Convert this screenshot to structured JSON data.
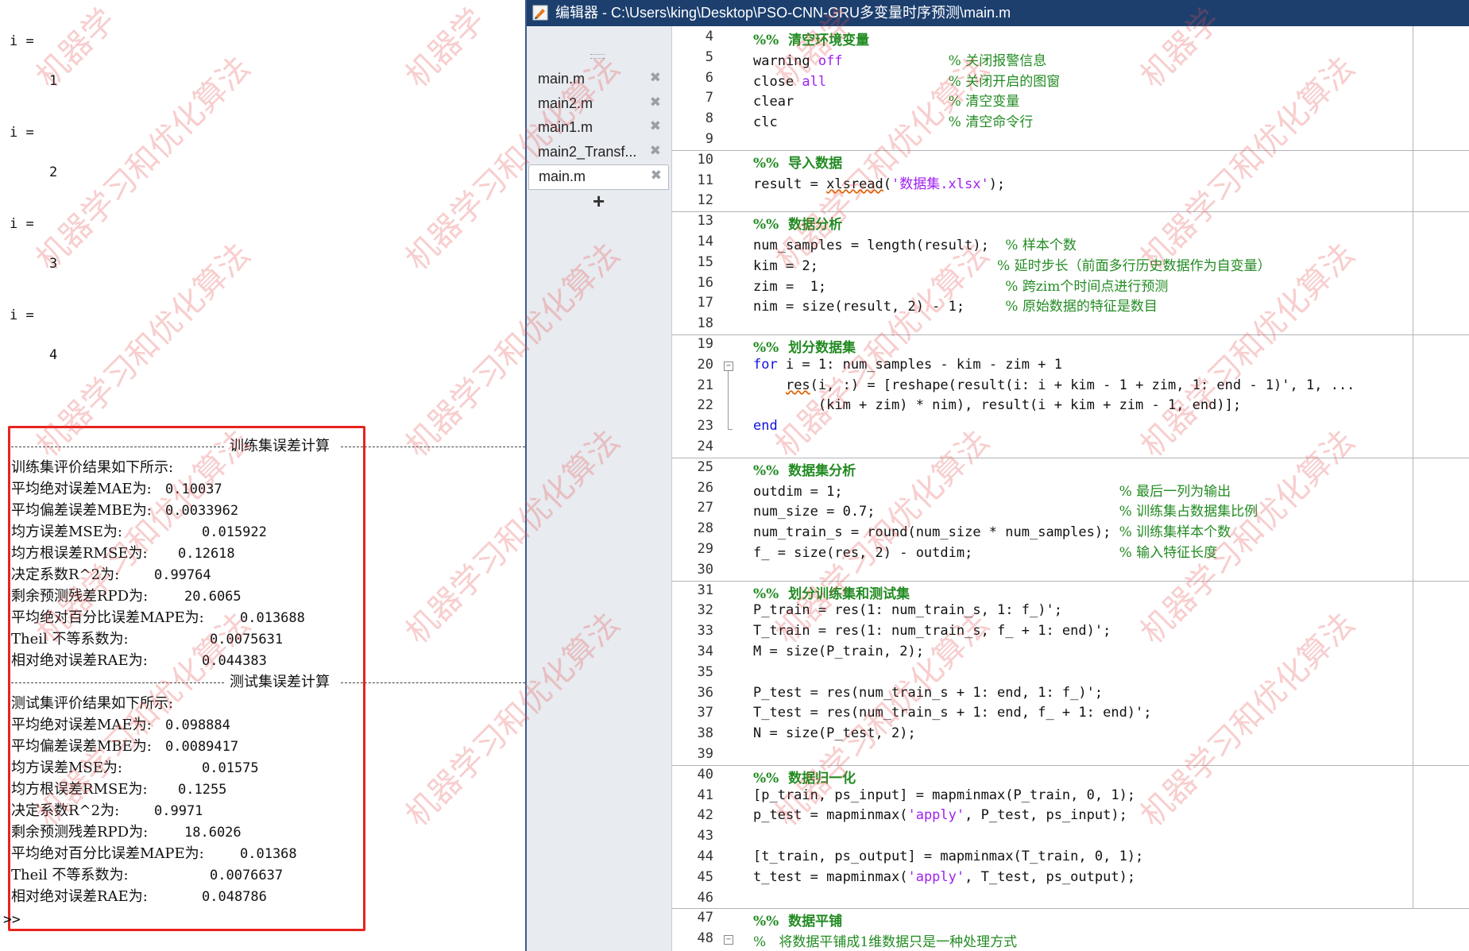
{
  "command_window": {
    "loop_output": [
      {
        "var": "i =",
        "value": "1"
      },
      {
        "var": "i =",
        "value": "2"
      },
      {
        "var": "i =",
        "value": "3"
      },
      {
        "var": "i =",
        "value": "4"
      }
    ],
    "train_header": "训练集误差计算",
    "train_intro": "训练集评价结果如下所示:",
    "train_metrics": [
      {
        "label": "平均绝对误差MAE为:",
        "value": "0.10037"
      },
      {
        "label": "平均偏差误差MBE为:",
        "value": "0.0033962"
      },
      {
        "label": "均方误差MSE为:",
        "value": "0.015922"
      },
      {
        "label": "均方根误差RMSE为:",
        "value": "0.12618"
      },
      {
        "label": "决定系数R^2为:",
        "value": "0.99764"
      },
      {
        "label": "剩余预测残差RPD为:",
        "value": "20.6065"
      },
      {
        "label": "平均绝对百分比误差MAPE为:",
        "value": "0.013688"
      },
      {
        "label": "Theil 不等系数为:",
        "value": "0.0075631"
      },
      {
        "label": "相对绝对误差RAE为:",
        "value": "0.044383"
      }
    ],
    "test_header": "测试集误差计算",
    "test_intro": "测试集评价结果如下所示:",
    "test_metrics": [
      {
        "label": "平均绝对误差MAE为:",
        "value": "0.098884"
      },
      {
        "label": "平均偏差误差MBE为:",
        "value": "0.0089417"
      },
      {
        "label": "均方误差MSE为:",
        "value": "0.01575"
      },
      {
        "label": "均方根误差RMSE为:",
        "value": "0.1255"
      },
      {
        "label": "决定系数R^2为:",
        "value": "0.9971"
      },
      {
        "label": "剩余预测残差RPD为:",
        "value": "18.6026"
      },
      {
        "label": "平均绝对百分比误差MAPE为:",
        "value": "0.01368"
      },
      {
        "label": "Theil 不等系数为:",
        "value": "0.0076637"
      },
      {
        "label": "相对绝对误差RAE为:",
        "value": "0.048786"
      }
    ],
    "prompt": ">>",
    "highlight_color": "#e8231f"
  },
  "editor": {
    "title": "编辑器 - C:\\Users\\king\\Desktop\\PSO-CNN-GRU多变量时序预测\\main.m",
    "title_icon": "matlab-editor-icon",
    "tabs": [
      {
        "label": "main.m",
        "active": false
      },
      {
        "label": "main2.m",
        "active": false
      },
      {
        "label": "main1.m",
        "active": false
      },
      {
        "label": "main2_Transf...",
        "active": false
      },
      {
        "label": "main.m",
        "active": true
      }
    ],
    "add_tab_label": "+",
    "lines": [
      {
        "n": "4",
        "segs": [
          [
            "ch",
            "%%  清空环境变量"
          ]
        ]
      },
      {
        "n": "5",
        "segs": [
          [
            "t",
            "warning "
          ],
          [
            "s",
            "off"
          ],
          [
            "t",
            "             "
          ],
          [
            "c",
            "% 关闭报警信息"
          ]
        ]
      },
      {
        "n": "6",
        "segs": [
          [
            "t",
            "close "
          ],
          [
            "s",
            "all"
          ],
          [
            "t",
            "               "
          ],
          [
            "c",
            "% 关闭开启的图窗"
          ]
        ]
      },
      {
        "n": "7",
        "segs": [
          [
            "t",
            "clear"
          ],
          [
            "t",
            "                   "
          ],
          [
            "c",
            "% 清空变量"
          ]
        ]
      },
      {
        "n": "8",
        "segs": [
          [
            "t",
            "clc"
          ],
          [
            "t",
            "                     "
          ],
          [
            "c",
            "% 清空命令行"
          ]
        ]
      },
      {
        "n": "9",
        "segs": []
      },
      {
        "n": "10",
        "segs": [
          [
            "ch",
            "%%  导入数据"
          ]
        ]
      },
      {
        "n": "11",
        "segs": [
          [
            "t",
            "result = "
          ],
          [
            "w",
            "xlsread"
          ],
          [
            "t",
            "("
          ],
          [
            "s",
            "'数据集.xlsx'"
          ],
          [
            "t",
            ");"
          ]
        ]
      },
      {
        "n": "12",
        "segs": []
      },
      {
        "n": "13",
        "segs": [
          [
            "ch",
            "%%  数据分析"
          ]
        ]
      },
      {
        "n": "14",
        "segs": [
          [
            "t",
            "num_samples = length(result);  "
          ],
          [
            "c",
            "% 样本个数"
          ]
        ]
      },
      {
        "n": "15",
        "segs": [
          [
            "t",
            "kim = 2;                      "
          ],
          [
            "c",
            "% 延时步长（前面多行历史数据作为自变量）"
          ]
        ]
      },
      {
        "n": "16",
        "segs": [
          [
            "t",
            "zim =  1;                      "
          ],
          [
            "c",
            "% 跨zim个时间点进行预测"
          ]
        ]
      },
      {
        "n": "17",
        "segs": [
          [
            "t",
            "nim = size(result, 2) - 1;     "
          ],
          [
            "c",
            "% 原始数据的特征是数目"
          ]
        ]
      },
      {
        "n": "18",
        "segs": []
      },
      {
        "n": "19",
        "segs": [
          [
            "ch",
            "%%  划分数据集"
          ]
        ]
      },
      {
        "n": "20",
        "segs": [
          [
            "k",
            "for"
          ],
          [
            "t",
            " i = 1: num_samples - kim - zim + 1"
          ]
        ]
      },
      {
        "n": "21",
        "segs": [
          [
            "t",
            "    "
          ],
          [
            "w",
            "res"
          ],
          [
            "t",
            "(i, :) = [reshape(result(i: i + kim - 1 + zim, 1: end - 1)', 1, ..."
          ]
        ]
      },
      {
        "n": "22",
        "segs": [
          [
            "t",
            "        (kim + zim) * nim), result(i + kim + zim - 1, end)];"
          ]
        ]
      },
      {
        "n": "23",
        "segs": [
          [
            "k",
            "end"
          ]
        ]
      },
      {
        "n": "24",
        "segs": []
      },
      {
        "n": "25",
        "segs": [
          [
            "ch",
            "%%  数据集分析"
          ]
        ]
      },
      {
        "n": "26",
        "segs": [
          [
            "t",
            "outdim = 1;                                  "
          ],
          [
            "c",
            "% 最后一列为输出"
          ]
        ]
      },
      {
        "n": "27",
        "segs": [
          [
            "t",
            "num_size = 0.7;                              "
          ],
          [
            "c",
            "% 训练集占数据集比例"
          ]
        ]
      },
      {
        "n": "28",
        "segs": [
          [
            "t",
            "num_train_s = round(num_size * num_samples); "
          ],
          [
            "c",
            "% 训练集样本个数"
          ]
        ]
      },
      {
        "n": "29",
        "segs": [
          [
            "t",
            "f_ = size(res, 2) - outdim;                  "
          ],
          [
            "c",
            "% 输入特征长度"
          ]
        ]
      },
      {
        "n": "30",
        "segs": []
      },
      {
        "n": "31",
        "segs": [
          [
            "ch",
            "%%  划分训练集和测试集"
          ]
        ]
      },
      {
        "n": "32",
        "segs": [
          [
            "t",
            "P_train = res(1: num_train_s, 1: f_)';"
          ]
        ]
      },
      {
        "n": "33",
        "segs": [
          [
            "t",
            "T_train = res(1: num_train_s, f_ + 1: end)';"
          ]
        ]
      },
      {
        "n": "34",
        "segs": [
          [
            "t",
            "M = size(P_train, 2);"
          ]
        ]
      },
      {
        "n": "35",
        "segs": []
      },
      {
        "n": "36",
        "segs": [
          [
            "t",
            "P_test = res(num_train_s + 1: end, 1: f_)';"
          ]
        ]
      },
      {
        "n": "37",
        "segs": [
          [
            "t",
            "T_test = res(num_train_s + 1: end, f_ + 1: end)';"
          ]
        ]
      },
      {
        "n": "38",
        "segs": [
          [
            "t",
            "N = size(P_test, 2);"
          ]
        ]
      },
      {
        "n": "39",
        "segs": []
      },
      {
        "n": "40",
        "segs": [
          [
            "ch",
            "%%  数据归一化"
          ]
        ]
      },
      {
        "n": "41",
        "segs": [
          [
            "t",
            "[p_train, ps_input] = mapminmax(P_train, 0, 1);"
          ]
        ]
      },
      {
        "n": "42",
        "segs": [
          [
            "t",
            "p_test = mapminmax("
          ],
          [
            "s",
            "'apply'"
          ],
          [
            "t",
            ", P_test, ps_input);"
          ]
        ]
      },
      {
        "n": "43",
        "segs": []
      },
      {
        "n": "44",
        "segs": [
          [
            "t",
            "[t_train, ps_output] = mapminmax(T_train, 0, 1);"
          ]
        ]
      },
      {
        "n": "45",
        "segs": [
          [
            "t",
            "t_test = mapminmax("
          ],
          [
            "s",
            "'apply'"
          ],
          [
            "t",
            ", T_test, ps_output);"
          ]
        ]
      },
      {
        "n": "46",
        "segs": []
      },
      {
        "n": "47",
        "segs": [
          [
            "ch",
            "%%  数据平铺"
          ]
        ]
      },
      {
        "n": "48",
        "segs": [
          [
            "c",
            "%   将数据平铺成1维数据只是一种处理方式"
          ]
        ]
      }
    ],
    "colors": {
      "keyword": "#1010e0",
      "string": "#a020f0",
      "comment": "#228b22",
      "titlebar": "#1c3f6e"
    }
  },
  "watermark": {
    "short": "机器学",
    "long": "机器学习和优化算法"
  }
}
